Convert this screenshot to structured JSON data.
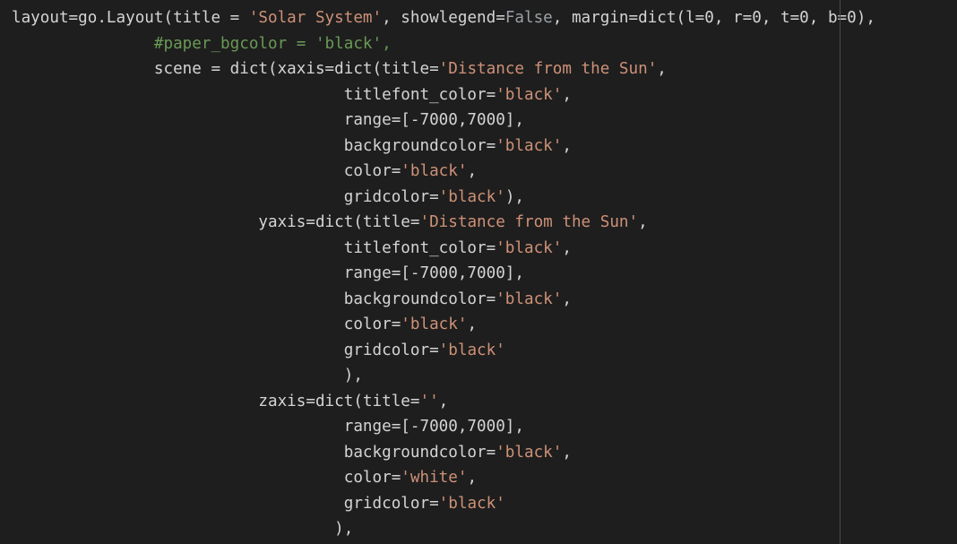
{
  "editor": {
    "colors": {
      "background": "#1e1e1e",
      "text": "#d4d4d4",
      "string": "#ce9178",
      "comment": "#6a9955",
      "ruler": "#4a4a4a"
    },
    "lines": [
      {
        "indent": "",
        "tokens": [
          {
            "t": "layout=go.Layout(title = ",
            "c": "plain"
          },
          {
            "t": "'Solar System'",
            "c": "str"
          },
          {
            "t": ", showlegend=",
            "c": "plain"
          },
          {
            "t": "False",
            "c": "dim"
          },
          {
            "t": ", margin=dict(l=0, r=0, t=0, b=0),",
            "c": "plain"
          }
        ]
      },
      {
        "indent": "               ",
        "tokens": [
          {
            "t": "#paper_bgcolor = 'black',",
            "c": "comment"
          }
        ]
      },
      {
        "indent": "               ",
        "tokens": [
          {
            "t": "scene = dict(xaxis=dict(title=",
            "c": "plain"
          },
          {
            "t": "'Distance from the Sun'",
            "c": "str"
          },
          {
            "t": ",",
            "c": "plain"
          }
        ]
      },
      {
        "indent": "                                   ",
        "tokens": [
          {
            "t": "titlefont_color=",
            "c": "plain"
          },
          {
            "t": "'black'",
            "c": "str"
          },
          {
            "t": ",",
            "c": "plain"
          }
        ]
      },
      {
        "indent": "                                   ",
        "tokens": [
          {
            "t": "range=[-7000,7000],",
            "c": "plain"
          }
        ]
      },
      {
        "indent": "                                   ",
        "tokens": [
          {
            "t": "backgroundcolor=",
            "c": "plain"
          },
          {
            "t": "'black'",
            "c": "str"
          },
          {
            "t": ",",
            "c": "plain"
          }
        ]
      },
      {
        "indent": "                                   ",
        "tokens": [
          {
            "t": "color=",
            "c": "plain"
          },
          {
            "t": "'black'",
            "c": "str"
          },
          {
            "t": ",",
            "c": "plain"
          }
        ]
      },
      {
        "indent": "                                   ",
        "tokens": [
          {
            "t": "gridcolor=",
            "c": "plain"
          },
          {
            "t": "'black'",
            "c": "str"
          },
          {
            "t": "),",
            "c": "plain"
          }
        ]
      },
      {
        "indent": "                          ",
        "tokens": [
          {
            "t": "yaxis=dict(title=",
            "c": "plain"
          },
          {
            "t": "'Distance from the Sun'",
            "c": "str"
          },
          {
            "t": ",",
            "c": "plain"
          }
        ]
      },
      {
        "indent": "                                   ",
        "tokens": [
          {
            "t": "titlefont_color=",
            "c": "plain"
          },
          {
            "t": "'black'",
            "c": "str"
          },
          {
            "t": ",",
            "c": "plain"
          }
        ]
      },
      {
        "indent": "                                   ",
        "tokens": [
          {
            "t": "range=[-7000,7000],",
            "c": "plain"
          }
        ]
      },
      {
        "indent": "                                   ",
        "tokens": [
          {
            "t": "backgroundcolor=",
            "c": "plain"
          },
          {
            "t": "'black'",
            "c": "str"
          },
          {
            "t": ",",
            "c": "plain"
          }
        ]
      },
      {
        "indent": "                                   ",
        "tokens": [
          {
            "t": "color=",
            "c": "plain"
          },
          {
            "t": "'black'",
            "c": "str"
          },
          {
            "t": ",",
            "c": "plain"
          }
        ]
      },
      {
        "indent": "                                   ",
        "tokens": [
          {
            "t": "gridcolor=",
            "c": "plain"
          },
          {
            "t": "'black'",
            "c": "str"
          }
        ]
      },
      {
        "indent": "                                   ",
        "tokens": [
          {
            "t": "),",
            "c": "plain"
          }
        ]
      },
      {
        "indent": "                          ",
        "tokens": [
          {
            "t": "zaxis=dict(title=",
            "c": "plain"
          },
          {
            "t": "''",
            "c": "str"
          },
          {
            "t": ",",
            "c": "plain"
          }
        ]
      },
      {
        "indent": "                                   ",
        "tokens": [
          {
            "t": "range=[-7000,7000],",
            "c": "plain"
          }
        ]
      },
      {
        "indent": "                                   ",
        "tokens": [
          {
            "t": "backgroundcolor=",
            "c": "plain"
          },
          {
            "t": "'black'",
            "c": "str"
          },
          {
            "t": ",",
            "c": "plain"
          }
        ]
      },
      {
        "indent": "                                   ",
        "tokens": [
          {
            "t": "color=",
            "c": "plain"
          },
          {
            "t": "'white'",
            "c": "str"
          },
          {
            "t": ",",
            "c": "plain"
          }
        ]
      },
      {
        "indent": "                                   ",
        "tokens": [
          {
            "t": "gridcolor=",
            "c": "plain"
          },
          {
            "t": "'black'",
            "c": "str"
          }
        ]
      },
      {
        "indent": "                                  ",
        "tokens": [
          {
            "t": "),",
            "c": "plain"
          }
        ]
      }
    ]
  }
}
